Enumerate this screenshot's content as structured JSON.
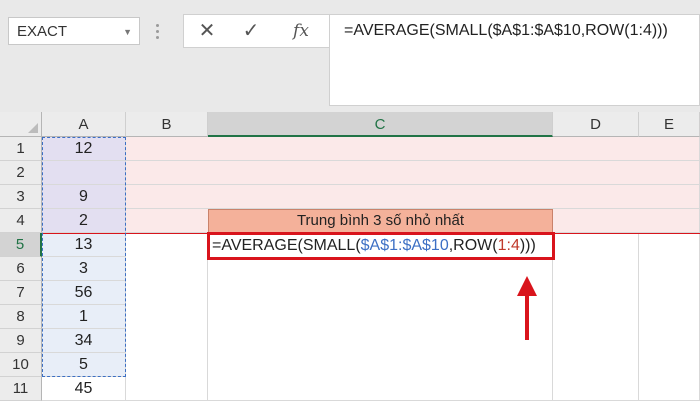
{
  "name_box": {
    "value": "EXACT"
  },
  "formula_bar": {
    "cancel_symbol": "✕",
    "enter_symbol": "✓",
    "fx_label": "fx",
    "formula": "=AVERAGE(SMALL($A$1:$A$10,ROW(1:4)))"
  },
  "columns": [
    "A",
    "B",
    "C",
    "D",
    "E"
  ],
  "rows": [
    "1",
    "2",
    "3",
    "4",
    "5",
    "6",
    "7",
    "8",
    "9",
    "10",
    "11"
  ],
  "column_a_values": [
    "12",
    "",
    "9",
    "2",
    "13",
    "3",
    "56",
    "1",
    "34",
    "5",
    "45"
  ],
  "c4_title": "Trung bình 3 số nhỏ nhất",
  "c5_formula": {
    "part1": "=AVERAGE(SMALL(",
    "ref_range": "$A$1:$A$10",
    "part2": ",ROW(",
    "ref_rows": "1:4",
    "part3": ")))"
  },
  "colors": {
    "highlight_red": "#d9141c",
    "ref_blue": "#3c6fc4",
    "title_fill": "#f4b19a",
    "excel_green": "#217346"
  }
}
